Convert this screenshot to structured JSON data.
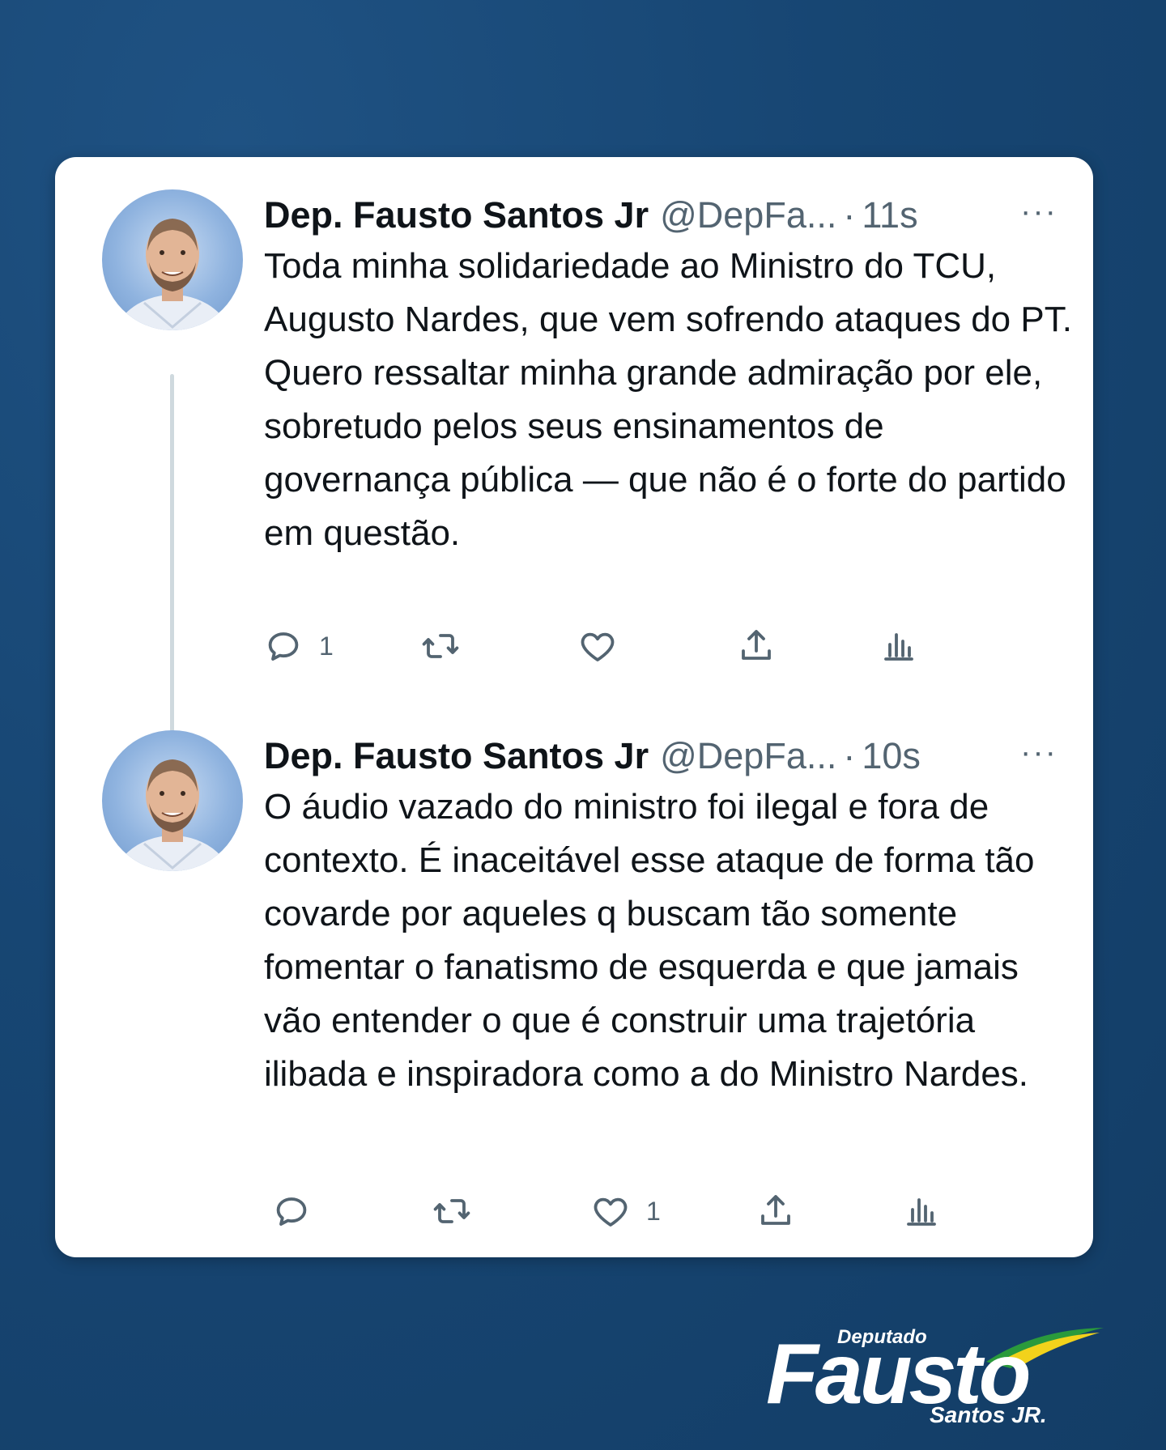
{
  "tweets": [
    {
      "name": "Dep. Fausto Santos Jr",
      "handle": "@DepFa...",
      "separator": "·",
      "time": "11s",
      "more": "···",
      "text": "Toda minha solidariedade ao Ministro do TCU, Augusto Nardes, que vem sofrendo ataques do PT. Quero ressaltar minha grande admiração por ele, sobretudo pelos seus ensinamentos de governança pública — que não é o forte do partido em questão.",
      "replies": "1",
      "retweets": "",
      "likes": "",
      "is_thread": true
    },
    {
      "name": "Dep. Fausto Santos Jr",
      "handle": "@DepFa...",
      "separator": "·",
      "time": "10s",
      "more": "···",
      "text": "O áudio vazado do ministro foi ilegal e fora de contexto. É inaceitável esse ataque de forma tão covarde por aqueles q buscam tão somente fomentar o fanatismo de esquerda e que jamais vão entender o que é construir uma trajetória ilibada e inspiradora como a do Ministro Nardes.",
      "replies": "",
      "retweets": "",
      "likes": "1",
      "is_thread": false
    }
  ],
  "icons": [
    "reply-icon",
    "retweet-icon",
    "like-icon",
    "share-icon",
    "analytics-icon"
  ],
  "logo": {
    "top": "Deputado",
    "main": "Fausto",
    "bottom": "Santos JR."
  },
  "colors": {
    "background": "#174673",
    "card": "#ffffff",
    "text": "#0f1419",
    "muted": "#536471",
    "thread_line": "#cfd9de"
  }
}
